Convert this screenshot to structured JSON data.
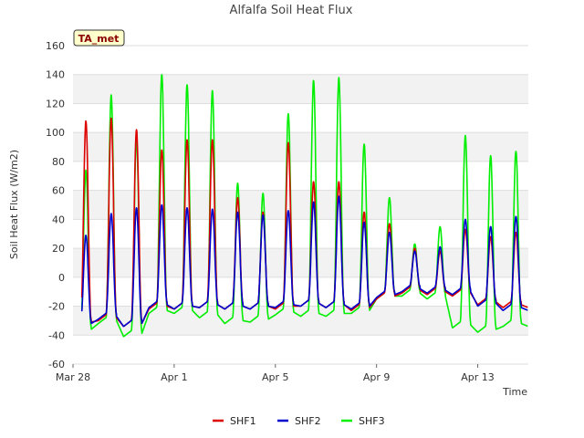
{
  "chart_data": {
    "type": "line",
    "title": "Alfalfa Soil Heat Flux",
    "xlabel": "Time",
    "ylabel": "Soil Heat Flux (W/m2)",
    "ylim": [
      -60,
      160
    ],
    "yticks": [
      -60,
      -40,
      -20,
      0,
      20,
      40,
      60,
      80,
      100,
      120,
      140,
      160
    ],
    "xlim": [
      "2024-03-28",
      "2024-04-15"
    ],
    "xticks": [
      {
        "value": "2024-03-28",
        "label": "Mar 28"
      },
      {
        "value": "2024-04-01",
        "label": "Apr 1"
      },
      {
        "value": "2024-04-05",
        "label": "Apr 5"
      },
      {
        "value": "2024-04-09",
        "label": "Apr 9"
      },
      {
        "value": "2024-04-13",
        "label": "Apr 13"
      }
    ],
    "grid": true,
    "legend_position": "bottom",
    "badge": "TA_met",
    "daily_peaks": {
      "dates": [
        "2024-03-28",
        "2024-03-29",
        "2024-03-30",
        "2024-03-31",
        "2024-04-01",
        "2024-04-02",
        "2024-04-03",
        "2024-04-04",
        "2024-04-05",
        "2024-04-06",
        "2024-04-07",
        "2024-04-08",
        "2024-04-09",
        "2024-04-10",
        "2024-04-11",
        "2024-04-12",
        "2024-04-13",
        "2024-04-14"
      ],
      "series": [
        {
          "name": "SHF1",
          "color": "#dd0000",
          "peak": [
            108,
            110,
            102,
            88,
            95,
            95,
            55,
            45,
            93,
            66,
            66,
            45,
            37,
            20,
            18,
            33,
            28,
            31
          ],
          "night_min": [
            -33,
            -30,
            -34,
            -22,
            -22,
            -21,
            -22,
            -22,
            -22,
            -20,
            -21,
            -23,
            -15,
            -11,
            -12,
            -13,
            -19,
            -21
          ]
        },
        {
          "name": "SHF2",
          "color": "#0000cc",
          "peak": [
            29,
            44,
            48,
            50,
            48,
            47,
            45,
            43,
            46,
            52,
            56,
            38,
            31,
            18,
            21,
            40,
            35,
            42
          ],
          "night_min": [
            -34,
            -29,
            -34,
            -21,
            -22,
            -21,
            -22,
            -22,
            -21,
            -20,
            -21,
            -22,
            -14,
            -10,
            -11,
            -12,
            -20,
            -23
          ]
        },
        {
          "name": "SHF3",
          "color": "#00ee00",
          "peak": [
            74,
            126,
            95,
            140,
            133,
            129,
            65,
            58,
            113,
            136,
            138,
            92,
            55,
            23,
            35,
            98,
            84,
            87
          ],
          "night_min": [
            -38,
            -32,
            -41,
            -25,
            -25,
            -28,
            -32,
            -31,
            -26,
            -27,
            -27,
            -25,
            -15,
            -13,
            -15,
            -35,
            -38,
            -34
          ]
        }
      ]
    }
  }
}
